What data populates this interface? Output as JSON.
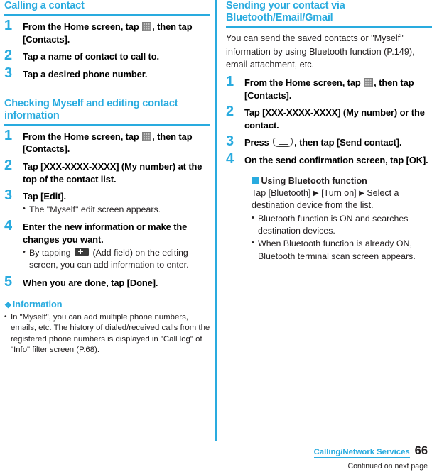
{
  "accent_color": "#29abdf",
  "text_color": "#231f20",
  "left_column": {
    "section1": {
      "title": "Calling a contact",
      "steps": [
        {
          "number": "1",
          "text_before_icon": "From the Home screen, tap",
          "icon": "launcher-grid-icon",
          "text_after_icon": ", then tap [Contacts]."
        },
        {
          "number": "2",
          "text": "Tap a name of contact to call to."
        },
        {
          "number": "3",
          "text": "Tap a desired phone number."
        }
      ]
    },
    "section2": {
      "title": "Checking Myself and editing contact information",
      "steps": [
        {
          "number": "1",
          "text_before_icon": "From the Home screen, tap",
          "icon": "launcher-grid-icon",
          "text_after_icon": ", then tap [Contacts]."
        },
        {
          "number": "2",
          "text": "Tap [XXX-XXXX-XXXX] (My number) at the top of the contact list."
        },
        {
          "number": "3",
          "text": "Tap [Edit].",
          "bullets": [
            "The \"Myself\" edit screen appears."
          ]
        },
        {
          "number": "4",
          "text": "Enter the new information or make the changes you want.",
          "bullet_before_icon": "By tapping",
          "bullet_icon": "add-field-icon",
          "bullet_after_icon": "(Add field) on the editing screen, you can add information to enter."
        },
        {
          "number": "5",
          "text": "When you are done, tap [Done]."
        }
      ]
    },
    "information": {
      "icon": "diamond-cluster-icon",
      "heading": "Information",
      "items": [
        "In \"Myself\", you can add multiple phone numbers, emails, etc. The history of dialed/received calls from the registered phone numbers is displayed in \"Call log\" of \"Info\" filter screen (P.68)."
      ]
    }
  },
  "right_column": {
    "section": {
      "title": "Sending your contact via Bluetooth/Email/Gmail",
      "intro": "You can send the saved contacts or \"Myself\" information by using Bluetooth function (P.149), email attachment, etc.",
      "steps": [
        {
          "number": "1",
          "text_before_icon": "From the Home screen, tap",
          "icon": "launcher-grid-icon",
          "text_after_icon": ", then tap [Contacts]."
        },
        {
          "number": "2",
          "text": "Tap [XXX-XXXX-XXXX] (My number) or the contact."
        },
        {
          "number": "3",
          "text_before_icon": "Press",
          "icon": "menu-key-icon",
          "text_after_icon": ", then tap [Send contact]."
        },
        {
          "number": "4",
          "text": "On the send confirmation screen, tap [OK]."
        }
      ],
      "subsection": {
        "icon": "blue-square-icon",
        "heading": "Using Bluetooth function",
        "body_part1": "Tap [Bluetooth]",
        "arrow1": "▶",
        "body_part2": "[Turn on]",
        "arrow2": "▶",
        "body_part3": "Select a destination device from the list.",
        "bullets": [
          "Bluetooth function is ON and searches destination devices.",
          "When Bluetooth function is already ON, Bluetooth terminal scan screen appears."
        ]
      }
    }
  },
  "footer": {
    "tab_label": "Calling/Network Services",
    "page_number": "66",
    "continued": "Continued on next page"
  }
}
